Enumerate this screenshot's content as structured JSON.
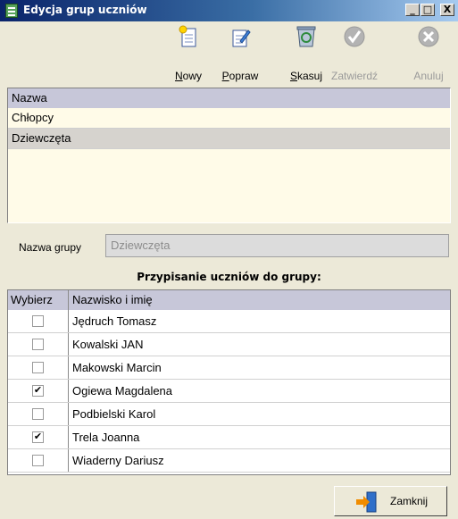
{
  "window": {
    "title": "Edycja grup uczniów",
    "controls": [
      "_",
      "□",
      "X"
    ]
  },
  "toolbar": {
    "buttons": [
      {
        "key": "N",
        "rest": "owy",
        "label": "Nowy",
        "icon": "new-document-icon",
        "enabled": true
      },
      {
        "key": "P",
        "rest": "opraw",
        "label": "Popraw",
        "icon": "edit-document-icon",
        "enabled": true
      },
      {
        "key": "S",
        "rest": "kasuj",
        "label": "Skasuj",
        "icon": "recycle-bin-icon",
        "enabled": true
      },
      {
        "key": "",
        "rest": "Zatwierdź",
        "label": "Zatwierdź",
        "icon": "check-icon",
        "enabled": false
      },
      {
        "key": "",
        "rest": "Anuluj",
        "label": "Anuluj",
        "icon": "cancel-icon",
        "enabled": false
      }
    ]
  },
  "groups": {
    "header": "Nazwa",
    "rows": [
      "Chłopcy",
      "Dziewczęta"
    ],
    "selected": "Dziewczęta"
  },
  "group_name": {
    "label": "Nazwa grupy",
    "value": "Dziewczęta"
  },
  "assignment": {
    "title": "Przypisanie uczniów do grupy:",
    "headers": [
      "Wybierz",
      "Nazwisko i imię"
    ],
    "rows": [
      {
        "name": "Jędruch Tomasz",
        "checked": false
      },
      {
        "name": "Kowalski JAN",
        "checked": false
      },
      {
        "name": "Makowski Marcin",
        "checked": false
      },
      {
        "name": "Ogiewa Magdalena",
        "checked": true
      },
      {
        "name": "Podbielski Karol",
        "checked": false
      },
      {
        "name": "Trela Joanna",
        "checked": true
      },
      {
        "name": "Wiaderny Dariusz",
        "checked": false
      }
    ]
  },
  "close_button": {
    "label": "Zamknij"
  },
  "colors": {
    "title_bar": "#0a246a",
    "header_bg": "#c7c7d9",
    "list_bg": "#fffbe8",
    "selected_row": "#d6d3ce"
  }
}
